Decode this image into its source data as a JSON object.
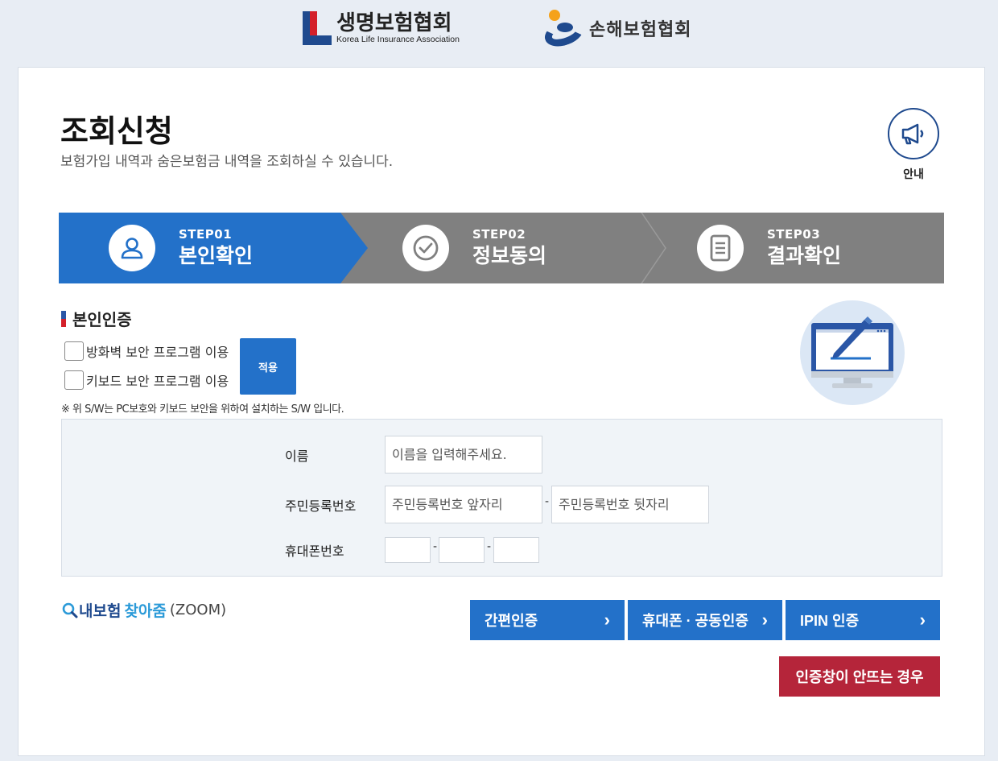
{
  "header": {
    "life_logo_ko": "생명보험협회",
    "life_logo_en": "Korea Life Insurance Association",
    "nonlife_logo_ko": "손해보험협회"
  },
  "page": {
    "title": "조회신청",
    "description": "보험가입 내역과 숨은보험금 내역을 조회하실 수 있습니다.",
    "guide_label": "안내"
  },
  "steps": [
    {
      "num": "STEP01",
      "name": "본인확인",
      "icon": "user-icon",
      "active": true
    },
    {
      "num": "STEP02",
      "name": "정보동의",
      "icon": "check-circle-icon",
      "active": false
    },
    {
      "num": "STEP03",
      "name": "결과확인",
      "icon": "document-icon",
      "active": false
    }
  ],
  "section": {
    "title": "본인인증",
    "checkbox_firewall": "방화벽 보안 프로그램 이용",
    "checkbox_keyboard": "키보드 보안 프로그램 이용",
    "apply_label": "적용",
    "sw_note": "※ 위 S/W는 PC보호와 키보드 보안을 위하여 설치하는 S/W 입니다."
  },
  "form": {
    "name_label": "이름",
    "name_placeholder": "이름을 입력해주세요.",
    "rrn_label": "주민등록번호",
    "rrn_front_placeholder": "주민등록번호 앞자리",
    "rrn_back_placeholder": "주민등록번호 뒷자리",
    "phone_label": "휴대폰번호",
    "dash": "-"
  },
  "zoom": {
    "part1": "내보험",
    "part2": "찾아줌",
    "part3": "(ZOOM)"
  },
  "buttons": {
    "simple_auth": "간편인증",
    "phone_cert": "휴대폰 · 공동인증",
    "ipin": "IPIN 인증",
    "help": "인증창이 안뜨는 경우",
    "chevron": "›"
  },
  "colors": {
    "primary": "#2371c9",
    "step_inactive": "#808080",
    "help": "#b5253a",
    "navy": "#1f4a8e"
  }
}
